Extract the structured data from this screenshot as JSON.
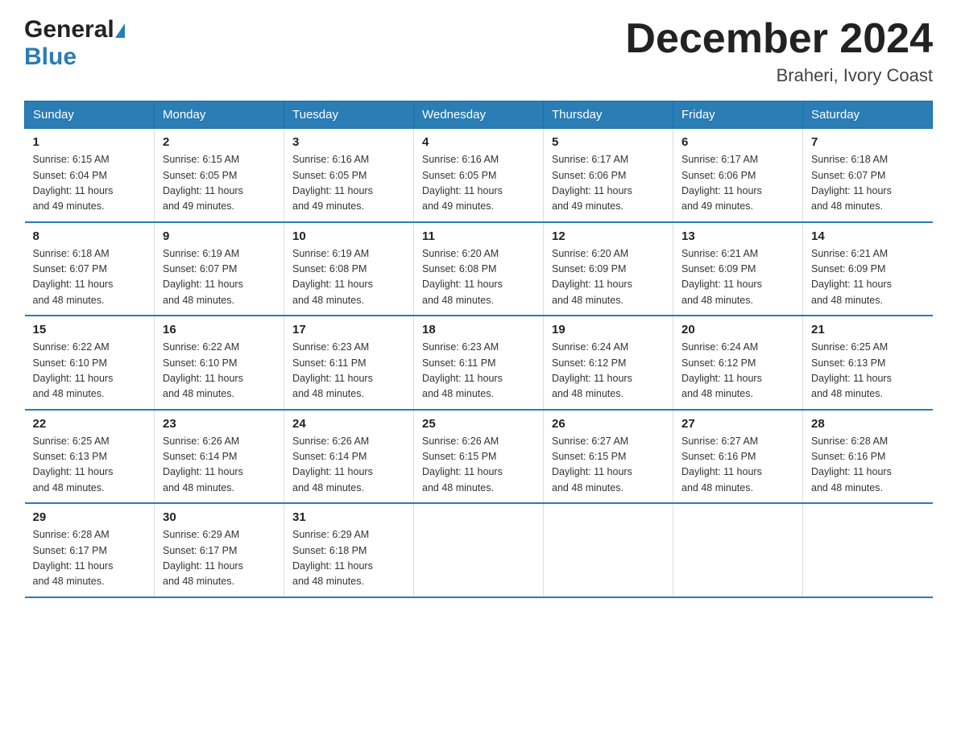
{
  "header": {
    "logo_general": "General",
    "logo_blue": "Blue",
    "month_title": "December 2024",
    "location": "Braheri, Ivory Coast"
  },
  "weekdays": [
    "Sunday",
    "Monday",
    "Tuesday",
    "Wednesday",
    "Thursday",
    "Friday",
    "Saturday"
  ],
  "weeks": [
    [
      {
        "day": "1",
        "sunrise": "6:15 AM",
        "sunset": "6:04 PM",
        "daylight": "11 hours and 49 minutes."
      },
      {
        "day": "2",
        "sunrise": "6:15 AM",
        "sunset": "6:05 PM",
        "daylight": "11 hours and 49 minutes."
      },
      {
        "day": "3",
        "sunrise": "6:16 AM",
        "sunset": "6:05 PM",
        "daylight": "11 hours and 49 minutes."
      },
      {
        "day": "4",
        "sunrise": "6:16 AM",
        "sunset": "6:05 PM",
        "daylight": "11 hours and 49 minutes."
      },
      {
        "day": "5",
        "sunrise": "6:17 AM",
        "sunset": "6:06 PM",
        "daylight": "11 hours and 49 minutes."
      },
      {
        "day": "6",
        "sunrise": "6:17 AM",
        "sunset": "6:06 PM",
        "daylight": "11 hours and 49 minutes."
      },
      {
        "day": "7",
        "sunrise": "6:18 AM",
        "sunset": "6:07 PM",
        "daylight": "11 hours and 48 minutes."
      }
    ],
    [
      {
        "day": "8",
        "sunrise": "6:18 AM",
        "sunset": "6:07 PM",
        "daylight": "11 hours and 48 minutes."
      },
      {
        "day": "9",
        "sunrise": "6:19 AM",
        "sunset": "6:07 PM",
        "daylight": "11 hours and 48 minutes."
      },
      {
        "day": "10",
        "sunrise": "6:19 AM",
        "sunset": "6:08 PM",
        "daylight": "11 hours and 48 minutes."
      },
      {
        "day": "11",
        "sunrise": "6:20 AM",
        "sunset": "6:08 PM",
        "daylight": "11 hours and 48 minutes."
      },
      {
        "day": "12",
        "sunrise": "6:20 AM",
        "sunset": "6:09 PM",
        "daylight": "11 hours and 48 minutes."
      },
      {
        "day": "13",
        "sunrise": "6:21 AM",
        "sunset": "6:09 PM",
        "daylight": "11 hours and 48 minutes."
      },
      {
        "day": "14",
        "sunrise": "6:21 AM",
        "sunset": "6:09 PM",
        "daylight": "11 hours and 48 minutes."
      }
    ],
    [
      {
        "day": "15",
        "sunrise": "6:22 AM",
        "sunset": "6:10 PM",
        "daylight": "11 hours and 48 minutes."
      },
      {
        "day": "16",
        "sunrise": "6:22 AM",
        "sunset": "6:10 PM",
        "daylight": "11 hours and 48 minutes."
      },
      {
        "day": "17",
        "sunrise": "6:23 AM",
        "sunset": "6:11 PM",
        "daylight": "11 hours and 48 minutes."
      },
      {
        "day": "18",
        "sunrise": "6:23 AM",
        "sunset": "6:11 PM",
        "daylight": "11 hours and 48 minutes."
      },
      {
        "day": "19",
        "sunrise": "6:24 AM",
        "sunset": "6:12 PM",
        "daylight": "11 hours and 48 minutes."
      },
      {
        "day": "20",
        "sunrise": "6:24 AM",
        "sunset": "6:12 PM",
        "daylight": "11 hours and 48 minutes."
      },
      {
        "day": "21",
        "sunrise": "6:25 AM",
        "sunset": "6:13 PM",
        "daylight": "11 hours and 48 minutes."
      }
    ],
    [
      {
        "day": "22",
        "sunrise": "6:25 AM",
        "sunset": "6:13 PM",
        "daylight": "11 hours and 48 minutes."
      },
      {
        "day": "23",
        "sunrise": "6:26 AM",
        "sunset": "6:14 PM",
        "daylight": "11 hours and 48 minutes."
      },
      {
        "day": "24",
        "sunrise": "6:26 AM",
        "sunset": "6:14 PM",
        "daylight": "11 hours and 48 minutes."
      },
      {
        "day": "25",
        "sunrise": "6:26 AM",
        "sunset": "6:15 PM",
        "daylight": "11 hours and 48 minutes."
      },
      {
        "day": "26",
        "sunrise": "6:27 AM",
        "sunset": "6:15 PM",
        "daylight": "11 hours and 48 minutes."
      },
      {
        "day": "27",
        "sunrise": "6:27 AM",
        "sunset": "6:16 PM",
        "daylight": "11 hours and 48 minutes."
      },
      {
        "day": "28",
        "sunrise": "6:28 AM",
        "sunset": "6:16 PM",
        "daylight": "11 hours and 48 minutes."
      }
    ],
    [
      {
        "day": "29",
        "sunrise": "6:28 AM",
        "sunset": "6:17 PM",
        "daylight": "11 hours and 48 minutes."
      },
      {
        "day": "30",
        "sunrise": "6:29 AM",
        "sunset": "6:17 PM",
        "daylight": "11 hours and 48 minutes."
      },
      {
        "day": "31",
        "sunrise": "6:29 AM",
        "sunset": "6:18 PM",
        "daylight": "11 hours and 48 minutes."
      },
      null,
      null,
      null,
      null
    ]
  ],
  "labels": {
    "sunrise": "Sunrise:",
    "sunset": "Sunset:",
    "daylight": "Daylight:"
  }
}
